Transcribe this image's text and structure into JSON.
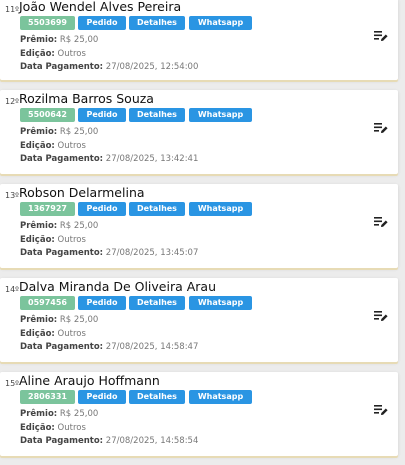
{
  "labels": {
    "premio": "Prêmio:",
    "edicao": "Edição:",
    "data_pagamento": "Data Pagamento:",
    "pedido": "Pedido",
    "detalhes": "Detalhes",
    "whatsapp": "Whatsapp"
  },
  "colors": {
    "code_badge": "#7bc49c",
    "action_button": "#2a95e3",
    "card_shadow": "#e7dbb5"
  },
  "icons": {
    "menu": "playlist-edit-icon"
  },
  "entries": [
    {
      "rank": "11º",
      "name": "João Wendel Alves Pereira",
      "code": "5503699",
      "premio": "R$ 25,00",
      "edicao": "Outros",
      "data": "27/08/2025, 12:54:00"
    },
    {
      "rank": "12º",
      "name": "Rozilma Barros Souza",
      "code": "5500642",
      "premio": "R$ 25,00",
      "edicao": "Outros",
      "data": "27/08/2025, 13:42:41"
    },
    {
      "rank": "13º",
      "name": "Robson Delarmelina",
      "code": "1367927",
      "premio": "R$ 25,00",
      "edicao": "Outros",
      "data": "27/08/2025, 13:45:07"
    },
    {
      "rank": "14º",
      "name": "Dalva Miranda De Oliveira Arau",
      "code": "0597456",
      "premio": "R$ 25,00",
      "edicao": "Outros",
      "data": "27/08/2025, 14:58:47"
    },
    {
      "rank": "15º",
      "name": "Aline Araujo Hoffmann",
      "code": "2806331",
      "premio": "R$ 25,00",
      "edicao": "Outros",
      "data": "27/08/2025, 14:58:54"
    }
  ]
}
